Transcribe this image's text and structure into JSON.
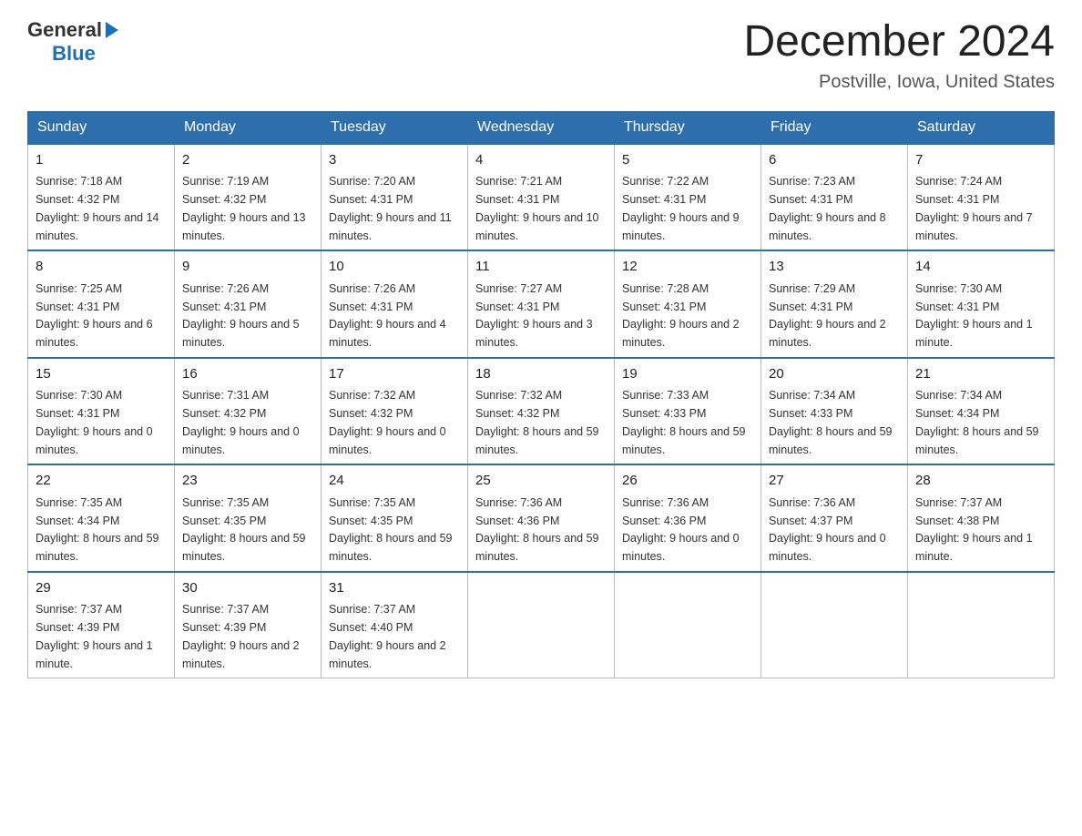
{
  "logo": {
    "general": "General",
    "blue": "Blue",
    "triangle": "▶"
  },
  "header": {
    "title": "December 2024",
    "subtitle": "Postville, Iowa, United States"
  },
  "weekdays": [
    "Sunday",
    "Monday",
    "Tuesday",
    "Wednesday",
    "Thursday",
    "Friday",
    "Saturday"
  ],
  "weeks": [
    [
      {
        "day": "1",
        "sunrise": "7:18 AM",
        "sunset": "4:32 PM",
        "daylight": "9 hours and 14 minutes."
      },
      {
        "day": "2",
        "sunrise": "7:19 AM",
        "sunset": "4:32 PM",
        "daylight": "9 hours and 13 minutes."
      },
      {
        "day": "3",
        "sunrise": "7:20 AM",
        "sunset": "4:31 PM",
        "daylight": "9 hours and 11 minutes."
      },
      {
        "day": "4",
        "sunrise": "7:21 AM",
        "sunset": "4:31 PM",
        "daylight": "9 hours and 10 minutes."
      },
      {
        "day": "5",
        "sunrise": "7:22 AM",
        "sunset": "4:31 PM",
        "daylight": "9 hours and 9 minutes."
      },
      {
        "day": "6",
        "sunrise": "7:23 AM",
        "sunset": "4:31 PM",
        "daylight": "9 hours and 8 minutes."
      },
      {
        "day": "7",
        "sunrise": "7:24 AM",
        "sunset": "4:31 PM",
        "daylight": "9 hours and 7 minutes."
      }
    ],
    [
      {
        "day": "8",
        "sunrise": "7:25 AM",
        "sunset": "4:31 PM",
        "daylight": "9 hours and 6 minutes."
      },
      {
        "day": "9",
        "sunrise": "7:26 AM",
        "sunset": "4:31 PM",
        "daylight": "9 hours and 5 minutes."
      },
      {
        "day": "10",
        "sunrise": "7:26 AM",
        "sunset": "4:31 PM",
        "daylight": "9 hours and 4 minutes."
      },
      {
        "day": "11",
        "sunrise": "7:27 AM",
        "sunset": "4:31 PM",
        "daylight": "9 hours and 3 minutes."
      },
      {
        "day": "12",
        "sunrise": "7:28 AM",
        "sunset": "4:31 PM",
        "daylight": "9 hours and 2 minutes."
      },
      {
        "day": "13",
        "sunrise": "7:29 AM",
        "sunset": "4:31 PM",
        "daylight": "9 hours and 2 minutes."
      },
      {
        "day": "14",
        "sunrise": "7:30 AM",
        "sunset": "4:31 PM",
        "daylight": "9 hours and 1 minute."
      }
    ],
    [
      {
        "day": "15",
        "sunrise": "7:30 AM",
        "sunset": "4:31 PM",
        "daylight": "9 hours and 0 minutes."
      },
      {
        "day": "16",
        "sunrise": "7:31 AM",
        "sunset": "4:32 PM",
        "daylight": "9 hours and 0 minutes."
      },
      {
        "day": "17",
        "sunrise": "7:32 AM",
        "sunset": "4:32 PM",
        "daylight": "9 hours and 0 minutes."
      },
      {
        "day": "18",
        "sunrise": "7:32 AM",
        "sunset": "4:32 PM",
        "daylight": "8 hours and 59 minutes."
      },
      {
        "day": "19",
        "sunrise": "7:33 AM",
        "sunset": "4:33 PM",
        "daylight": "8 hours and 59 minutes."
      },
      {
        "day": "20",
        "sunrise": "7:34 AM",
        "sunset": "4:33 PM",
        "daylight": "8 hours and 59 minutes."
      },
      {
        "day": "21",
        "sunrise": "7:34 AM",
        "sunset": "4:34 PM",
        "daylight": "8 hours and 59 minutes."
      }
    ],
    [
      {
        "day": "22",
        "sunrise": "7:35 AM",
        "sunset": "4:34 PM",
        "daylight": "8 hours and 59 minutes."
      },
      {
        "day": "23",
        "sunrise": "7:35 AM",
        "sunset": "4:35 PM",
        "daylight": "8 hours and 59 minutes."
      },
      {
        "day": "24",
        "sunrise": "7:35 AM",
        "sunset": "4:35 PM",
        "daylight": "8 hours and 59 minutes."
      },
      {
        "day": "25",
        "sunrise": "7:36 AM",
        "sunset": "4:36 PM",
        "daylight": "8 hours and 59 minutes."
      },
      {
        "day": "26",
        "sunrise": "7:36 AM",
        "sunset": "4:36 PM",
        "daylight": "9 hours and 0 minutes."
      },
      {
        "day": "27",
        "sunrise": "7:36 AM",
        "sunset": "4:37 PM",
        "daylight": "9 hours and 0 minutes."
      },
      {
        "day": "28",
        "sunrise": "7:37 AM",
        "sunset": "4:38 PM",
        "daylight": "9 hours and 1 minute."
      }
    ],
    [
      {
        "day": "29",
        "sunrise": "7:37 AM",
        "sunset": "4:39 PM",
        "daylight": "9 hours and 1 minute."
      },
      {
        "day": "30",
        "sunrise": "7:37 AM",
        "sunset": "4:39 PM",
        "daylight": "9 hours and 2 minutes."
      },
      {
        "day": "31",
        "sunrise": "7:37 AM",
        "sunset": "4:40 PM",
        "daylight": "9 hours and 2 minutes."
      },
      null,
      null,
      null,
      null
    ]
  ]
}
